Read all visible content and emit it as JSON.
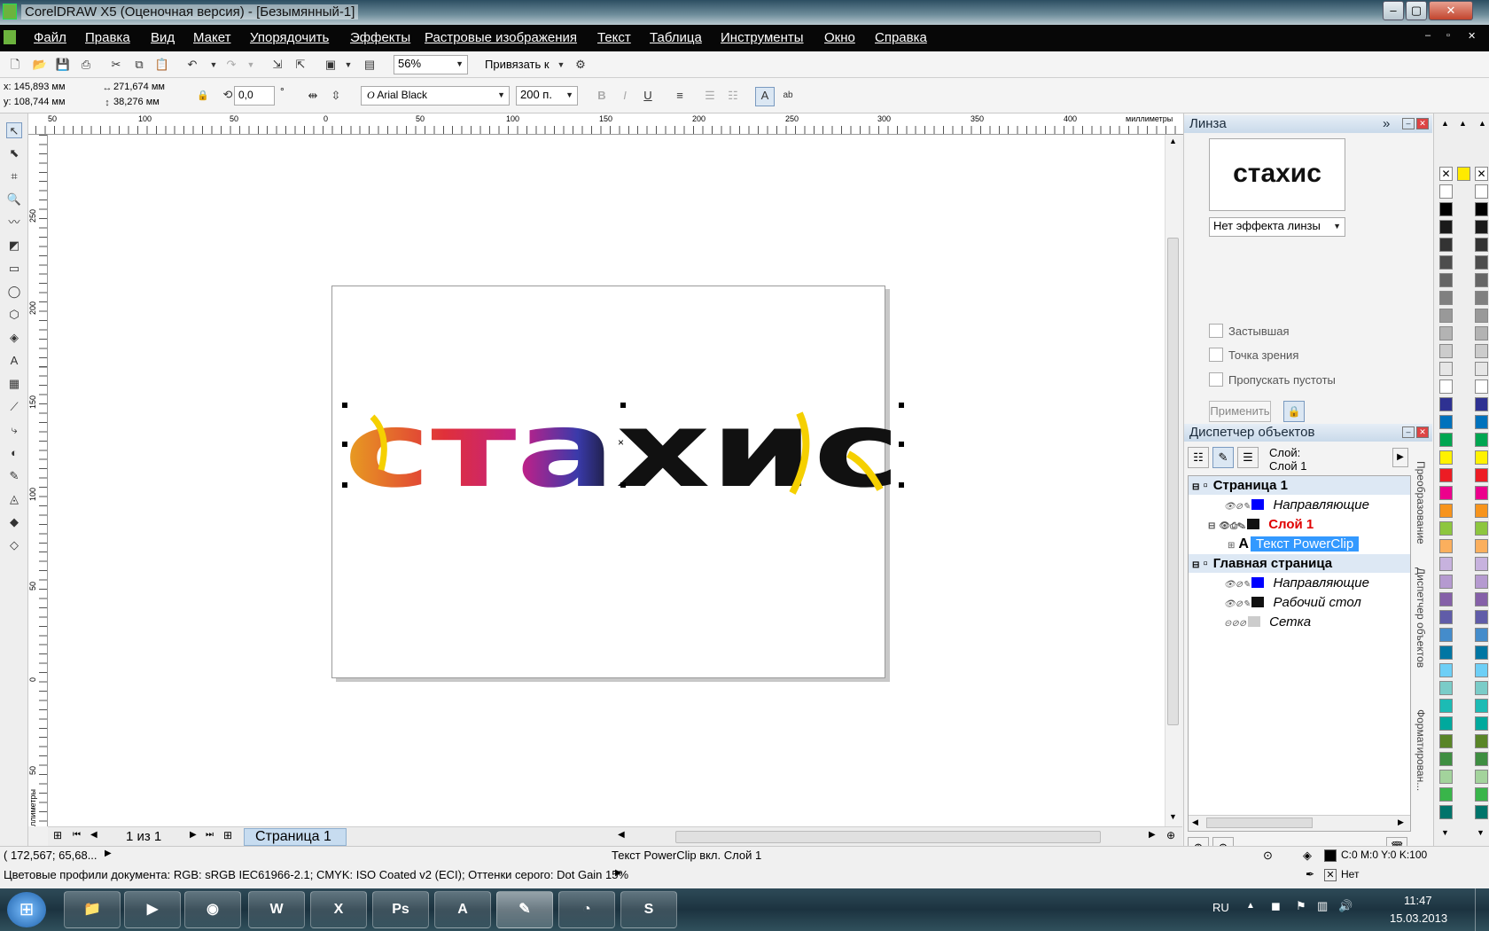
{
  "window": {
    "title": "CorelDRAW X5 (Оценочная версия) - [Безымянный-1]"
  },
  "menu": [
    "Файл",
    "Правка",
    "Вид",
    "Макет",
    "Упорядочить",
    "Эффекты",
    "Растровые изображения",
    "Текст",
    "Таблица",
    "Инструменты",
    "Окно",
    "Справка"
  ],
  "toolbar": {
    "zoom": "56%",
    "snap_label": "Привязать к"
  },
  "propbar": {
    "x": "x: 145,893 мм",
    "y": "y: 108,744 мм",
    "w": "271,674 мм",
    "h": "38,276 мм",
    "angle": "0,0",
    "degree": "°",
    "font": "Arial Black",
    "font_size": "200 п."
  },
  "ruler": {
    "top_ticks": [
      "50",
      "100",
      "50",
      "0",
      "50",
      "100",
      "150",
      "200",
      "250",
      "300",
      "350",
      "400"
    ],
    "top_unit": "миллиметры",
    "left_ticks": [
      "250",
      "200",
      "150",
      "100",
      "50",
      "0",
      "50"
    ],
    "left_unit": "миллиметры"
  },
  "document": {
    "text": "стахис"
  },
  "page_nav": {
    "counter": "1 из 1",
    "tab": "Страница 1"
  },
  "lens": {
    "title": "Линза",
    "preview_text": "стахис",
    "effect": "Нет эффекта линзы",
    "options": [
      "Застывшая",
      "Точка зрения",
      "Пропускать пустоты"
    ],
    "apply": "Применить"
  },
  "objmgr": {
    "title": "Диспетчер объектов",
    "layer_label": "Слой:",
    "layer_name": "Слой 1",
    "tree": {
      "page1": "Страница 1",
      "guides1": "Направляющие",
      "layer1": "Слой 1",
      "powerclip": "Текст PowerClip",
      "master": "Главная страница",
      "guides2": "Направляющие",
      "desktop": "Рабочий стол",
      "grid": "Сетка"
    }
  },
  "side_tabs": [
    "Преобразование",
    "Диспетчер объектов",
    "Форматирован..."
  ],
  "status": {
    "coords": "( 172,567; 65,68...",
    "selection": "Текст PowerClip вкл. Слой 1",
    "profiles": "Цветовые профили документа: RGB: sRGB IEC61966-2.1; CMYK: ISO Coated v2 (ECI); Оттенки серого: Dot Gain 15%",
    "fill": "C:0 M:0 Y:0 K:100",
    "outline": "Нет"
  },
  "taskbar": {
    "lang": "RU",
    "time": "11:47",
    "date": "15.03.2013"
  },
  "colors": {
    "accent_selected": "#3399ff",
    "layer_red": "#e00000",
    "palette": [
      "#ffffff",
      "#000000",
      "#1a1a1a",
      "#333333",
      "#4d4d4d",
      "#666666",
      "#808080",
      "#999999",
      "#b3b3b3",
      "#cccccc",
      "#e6e6e6",
      "#ffffff",
      "#2e3192",
      "#0072bc",
      "#00a651",
      "#fff200",
      "#ed1c24",
      "#ec008c",
      "#f7941d",
      "#8dc63f",
      "#fbaf5d",
      "#c7b2de",
      "#b59ad0",
      "#8560a8",
      "#605ca8",
      "#448ccb",
      "#0076a3",
      "#6dcff6",
      "#7accc8",
      "#1cbbb4",
      "#00a99d",
      "#598527",
      "#3e8e41",
      "#a3d39c",
      "#39b54a",
      "#00746b"
    ]
  }
}
